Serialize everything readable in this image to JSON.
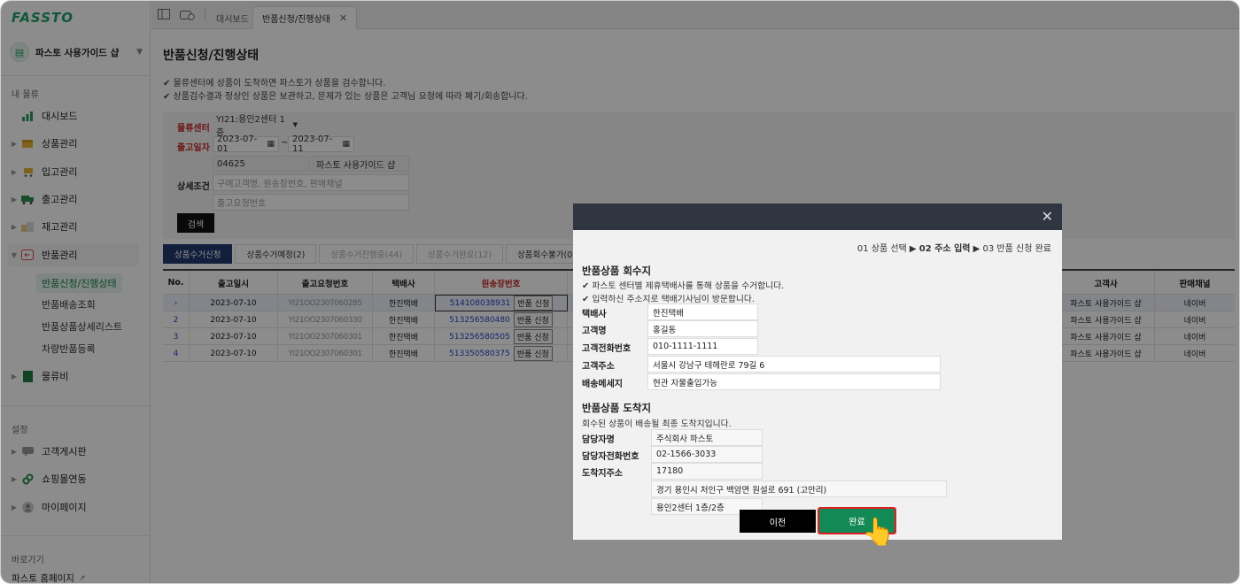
{
  "brand": {
    "logo": "FASSTO",
    "shop_name": "파스토 사용가이드 샵"
  },
  "sidebar": {
    "section_main": "내 물류",
    "items": [
      {
        "label": "대시보드",
        "icon": "chart-icon"
      },
      {
        "label": "상품관리",
        "icon": "box-icon"
      },
      {
        "label": "입고관리",
        "icon": "cart-icon"
      },
      {
        "label": "출고관리",
        "icon": "truck-icon"
      },
      {
        "label": "재고관리",
        "icon": "stock-icon"
      },
      {
        "label": "반품관리",
        "icon": "return-icon"
      }
    ],
    "return_sub": [
      "반품신청/진행상태",
      "반품배송조회",
      "반품상품상세리스트",
      "차량반품등록"
    ],
    "logistics_cost": "물류비",
    "section_settings": "설정",
    "settings_items": [
      "고객게시판",
      "쇼핑몰연동",
      "마이페이지"
    ],
    "section_shortcut": "바로가기",
    "homepage_link": "파스토 홈페이지"
  },
  "tabs": {
    "dashboard": "대시보드",
    "current": "반품신청/진행상태"
  },
  "page": {
    "title": "반품신청/진행상태",
    "info1": "✔ 물류센터에 상품이 도착하면 파스토가 상품을 검수합니다.",
    "info2": "✔ 상품검수결과 정상인 상품은 보관하고, 문제가 있는 상품은 고객님 요청에 따라 폐기/회송합니다."
  },
  "filter": {
    "center_label": "물류센터",
    "center_value": "YI21:용인2센터 1층",
    "date_label": "출고일자",
    "date_from": "2023-07-01",
    "date_to": "2023-07-11",
    "zip": "04625",
    "shop": "파스토 사용가이드 샵",
    "detail_label": "상세조건",
    "detail_placeholder1": "구매고객명, 원송장번호, 판매채널",
    "detail_placeholder2": "출고요청번호",
    "search_button": "검색"
  },
  "status_tabs": [
    {
      "label": "상품수거신청",
      "active": true
    },
    {
      "label": "상품수거예정(2)"
    },
    {
      "label": "상품수거진행중(44)"
    },
    {
      "label": "상품수거완료(12)"
    },
    {
      "label": "상품회수불가(0)"
    }
  ],
  "grid": {
    "headers": {
      "no": "No.",
      "date": "출고일시",
      "req": "출고요청번호",
      "courier": "택배사",
      "invoice": "원송장번호",
      "customer": "고객사",
      "channel": "판매채널"
    },
    "rows": [
      {
        "no": "1",
        "date": "2023-07-10",
        "req": "YI21OO2307060285",
        "courier": "한진택배",
        "invoice": "514108038931",
        "customer": "파스토 사용가이드 샵",
        "channel": "네이버"
      },
      {
        "no": "2",
        "date": "2023-07-10",
        "req": "YI21OO2307060330",
        "courier": "한진택배",
        "invoice": "513256580480",
        "customer": "파스토 사용가이드 샵",
        "channel": "네이버"
      },
      {
        "no": "3",
        "date": "2023-07-10",
        "req": "YI21OO2307060301",
        "courier": "한진택배",
        "invoice": "513256580505",
        "customer": "파스토 사용가이드 샵",
        "channel": "네이버"
      },
      {
        "no": "4",
        "date": "2023-07-10",
        "req": "YI21OO2307060301",
        "courier": "한진택배",
        "invoice": "513350580375",
        "customer": "파스토 사용가이드 샵",
        "channel": "네이버"
      }
    ],
    "return_button": "반품 신청"
  },
  "modal": {
    "steps": {
      "s1": "01 상품 선택 ▶ ",
      "s2": "02 주소 입력",
      "s3": " ▶ 03 반품 신청 완료"
    },
    "pickup_title": "반품상품 회수지",
    "pickup_note1": "✔ 파스토 센터별 제휴택배사를 통해 상품을 수거합니다.",
    "pickup_note2": "✔ 입력하신 주소지로 택배기사님이 방문합니다.",
    "labels": {
      "courier": "택배사",
      "customer": "고객명",
      "phone": "고객전화번호",
      "address": "고객주소",
      "message": "배송메세지"
    },
    "values": {
      "courier": "한진택배",
      "customer": "홍길동",
      "phone": "010-1111-1111",
      "address": "서울시 강남구 테헤란로 79길 6",
      "message": "현관 자물출입가능"
    },
    "dest_title": "반품상품 도착지",
    "dest_note": "회수된 상품이 배송될 최종 도착지입니다.",
    "dest_labels": {
      "manager": "담당자명",
      "manager_phone": "담당자전화번호",
      "address": "도착지주소"
    },
    "dest_values": {
      "manager": "주식회사 파스토",
      "manager_phone": "02-1566-3033",
      "zip": "17180",
      "addr1": "경기 용인시 처인구 백암면 원설로 691 (고안리)",
      "addr2": "용인2센터 1층/2층"
    },
    "prev_button": "이전",
    "done_button": "완료"
  }
}
